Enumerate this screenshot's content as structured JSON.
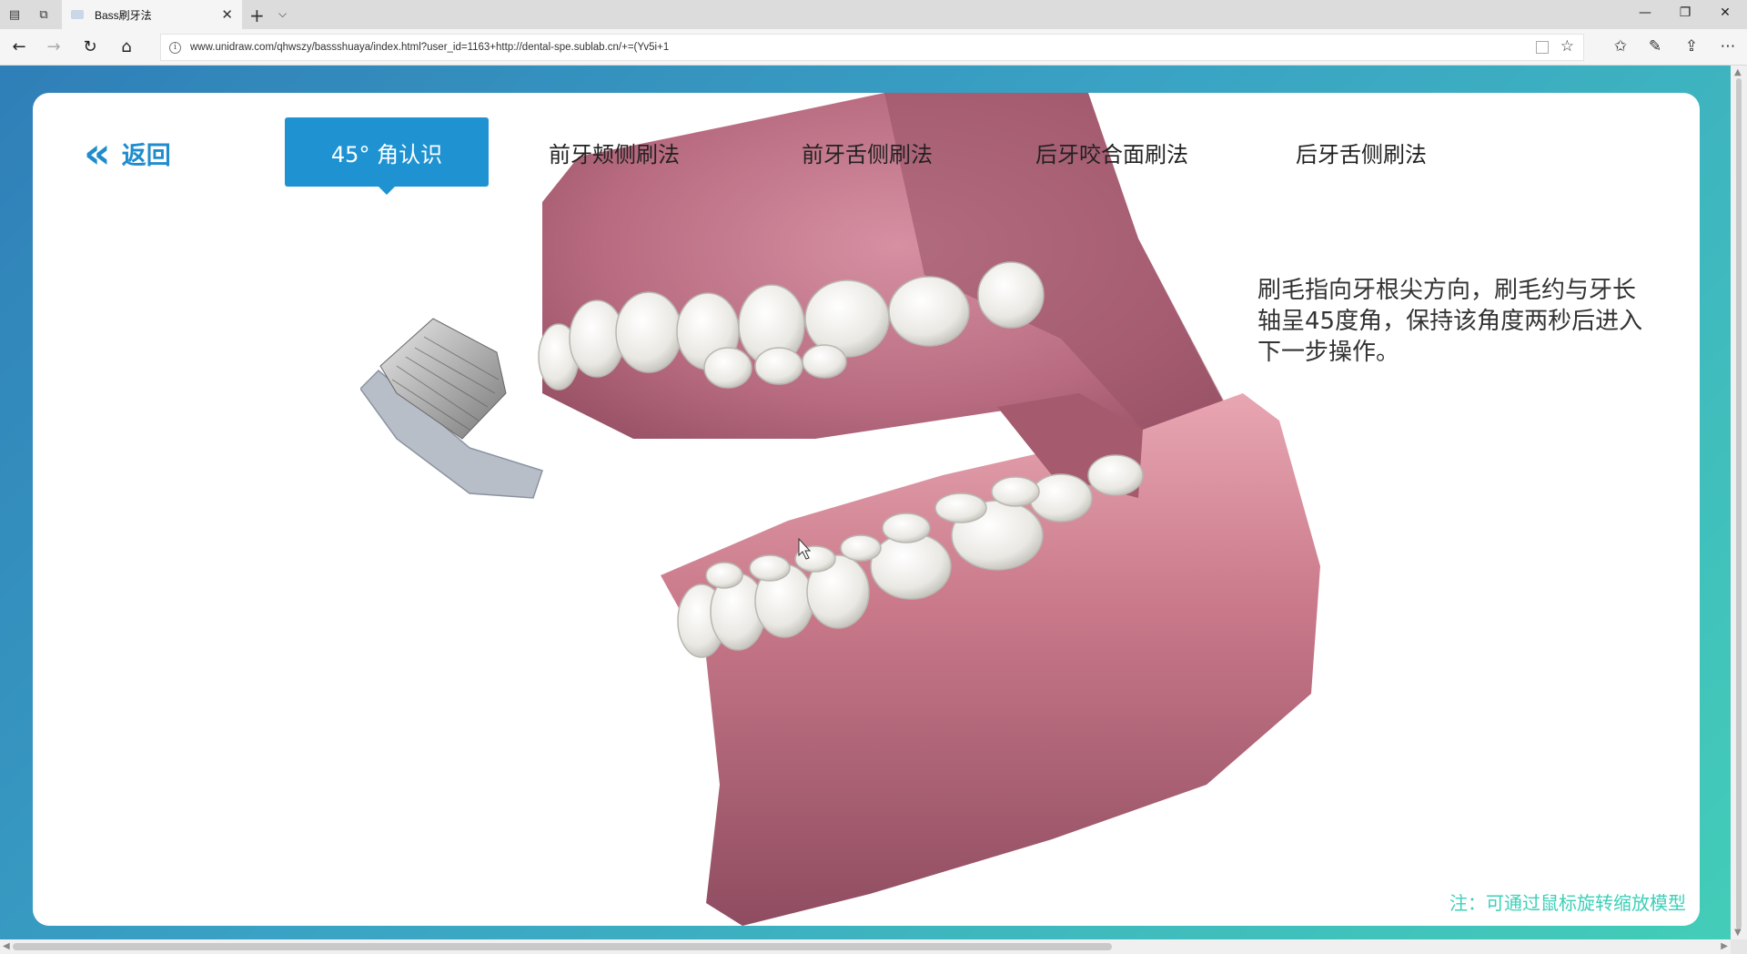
{
  "browser": {
    "tab_title": "Bass刷牙法",
    "url": "www.unidraw.com/qhwszy/bassshuaya/index.html?user_id=1163+http://dental-spe.sublab.cn/+=(Yv5i+1",
    "icons": {
      "tab_actions": "tab-actions-icon",
      "set_aside": "set-aside-tabs-icon",
      "new_tab": "+",
      "tab_list": "⌵",
      "close_tab": "✕",
      "back": "←",
      "forward": "→",
      "refresh": "↻",
      "home": "⌂",
      "info": "i",
      "favorite": "☆",
      "favorites_bar": "✩",
      "pen": "✎",
      "share": "⇪",
      "more": "⋯",
      "minimize": "—",
      "restore": "❐",
      "close_window": "✕"
    }
  },
  "page": {
    "back_label": "返回",
    "back_icon": "«",
    "tabs": [
      {
        "label": "45° 角认识",
        "active": true
      },
      {
        "label": "前牙颊侧刷法",
        "active": false
      },
      {
        "label": "前牙舌侧刷法",
        "active": false
      },
      {
        "label": "后牙咬合面刷法",
        "active": false
      },
      {
        "label": "后牙舌侧刷法",
        "active": false
      }
    ],
    "instruction": "刷毛指向牙根尖方向，刷毛约与牙长轴呈45度角，保持该角度两秒后进入下一步操作。",
    "note": "注：可通过鼠标旋转缩放模型"
  },
  "colors": {
    "accent": "#1f93d2",
    "note": "#3dd0b8",
    "gradient_start": "#2f7fb8",
    "gradient_end": "#43cdb8",
    "gum": "#c77a8d",
    "teeth": "#f2f2ef"
  }
}
